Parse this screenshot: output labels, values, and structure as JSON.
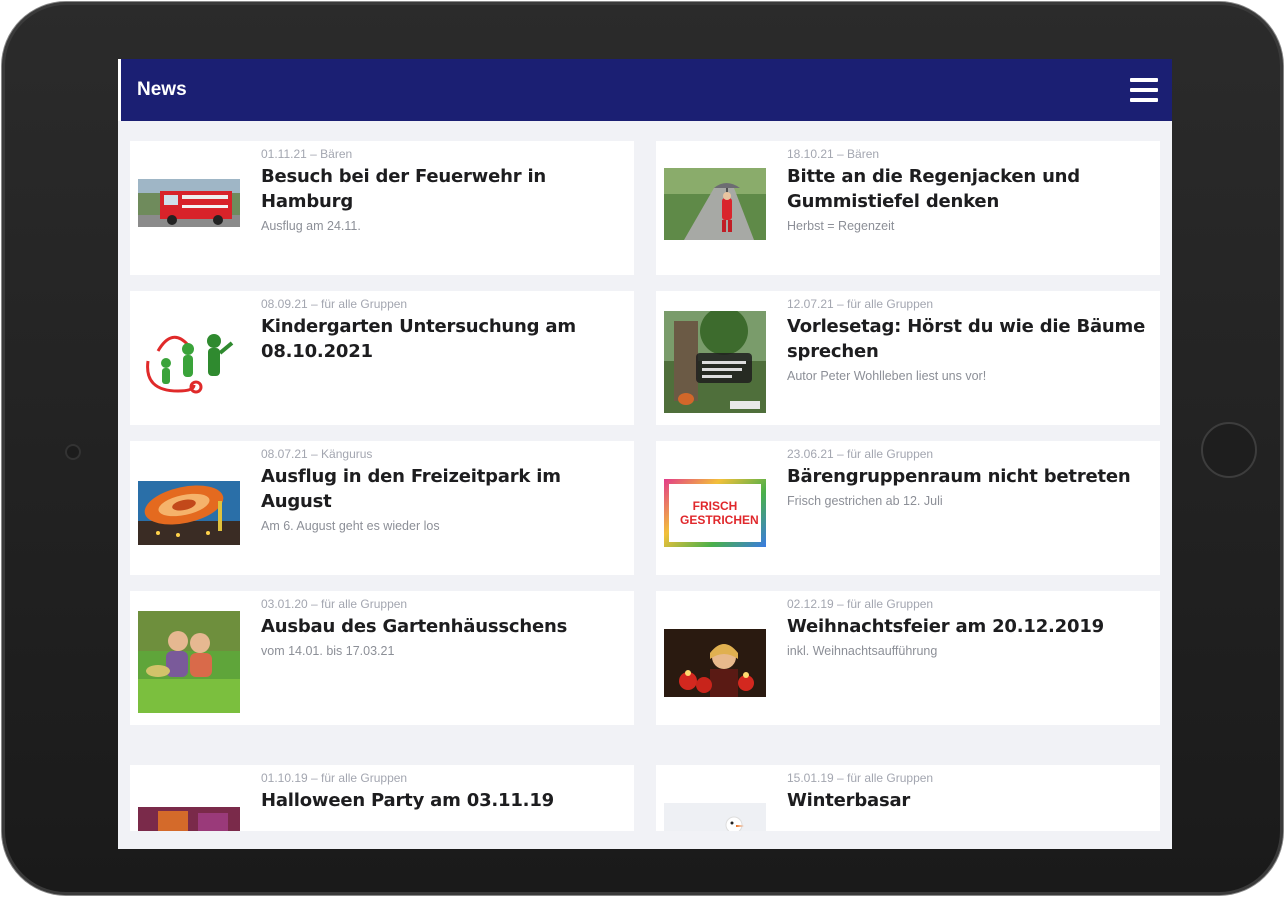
{
  "appbar": {
    "title": "News",
    "menu_icon": "hamburger-menu-icon",
    "color": "#1b1f73"
  },
  "news": [
    {
      "meta": "01.11.21 – Bären",
      "title": "Besuch bei der Feuerwehr in Hamburg",
      "subtitle": "Ausflug am 24.11.",
      "image": "fire-truck-photo"
    },
    {
      "meta": "18.10.21 – Bären",
      "title": "Bitte an die Regenjacken und Gummistiefel denken",
      "subtitle": "Herbst = Regenzeit",
      "image": "child-rain-umbrella-photo"
    },
    {
      "meta": "08.09.21 – für alle Gruppen",
      "title": "Kindergarten Untersuchung am 08.10.2021",
      "subtitle": "",
      "image": "stethoscope-kids-illustration"
    },
    {
      "meta": "12.07.21 – für alle Gruppen",
      "title": "Vorlesetag: Hörst du wie die Bäume sprechen",
      "subtitle": "Autor Peter Wohlleben liest uns vor!",
      "image": "book-cover-trees"
    },
    {
      "meta": "08.07.21 – Kängurus",
      "title": "Ausflug in den Freizeitpark im August",
      "subtitle": "Am 6. August geht es wieder los",
      "image": "amusement-ride-photo"
    },
    {
      "meta": "23.06.21 – für alle Gruppen",
      "title": "Bärengruppenraum nicht betreten",
      "subtitle": "Frisch gestrichen ab 12. Juli",
      "image": "frisch-gestrichen-sign",
      "image_text": "FRISCH GESTRICHEN"
    },
    {
      "meta": "03.01.20 – für alle Gruppen",
      "title": "Ausbau des Gartenhäusschens",
      "subtitle": "vom 14.01. bis 17.03.21",
      "image": "children-garden-photo"
    },
    {
      "meta": "02.12.19 – für alle Gruppen",
      "title": "Weihnachtsfeier am 20.12.2019",
      "subtitle": "inkl. Weihnachtsaufführung",
      "image": "girl-candles-photo"
    },
    {
      "meta": "01.10.19 – für alle Gruppen",
      "title": "Halloween Party am 03.11.19",
      "subtitle": "",
      "image": "halloween-photo"
    },
    {
      "meta": "15.01.19 – für alle Gruppen",
      "title": "Winterbasar",
      "subtitle": "",
      "image": "snowman-photo"
    }
  ]
}
